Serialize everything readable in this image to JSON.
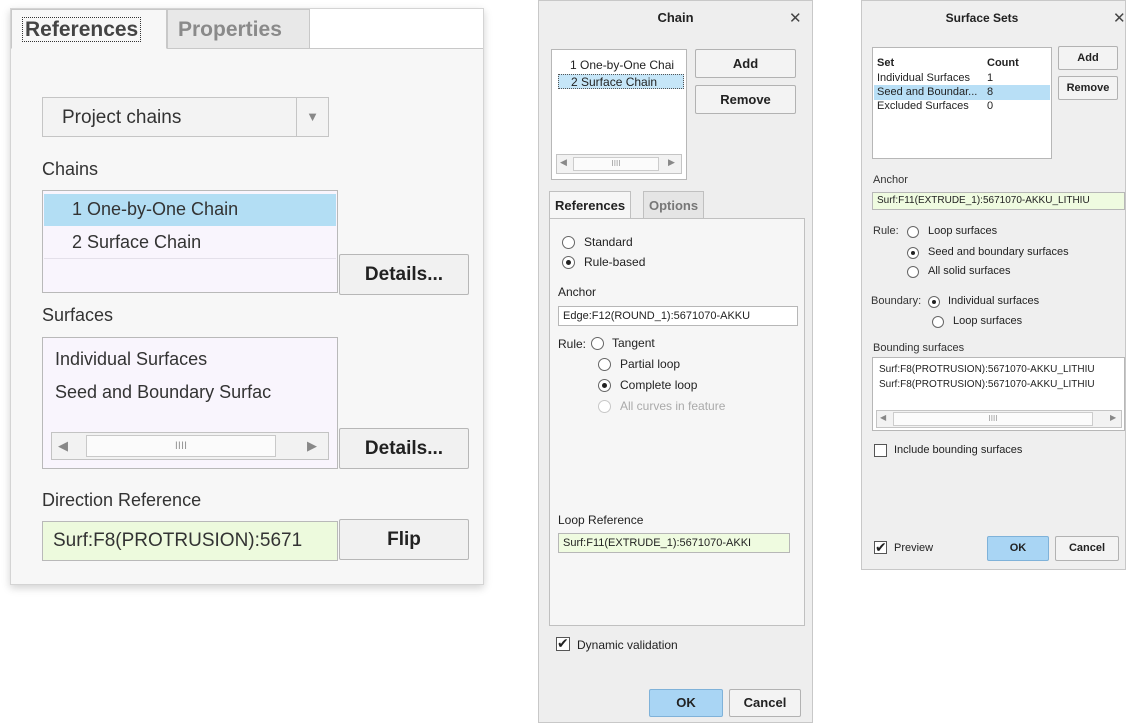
{
  "panel_references": {
    "tabs": [
      "References",
      "Properties"
    ],
    "dropdown_value": "Project chains",
    "chains_label": "Chains",
    "chains": [
      "1 One-by-One Chain",
      "2 Surface Chain"
    ],
    "details_label": "Details...",
    "surfaces_label": "Surfaces",
    "surfaces": [
      "Individual Surfaces",
      "Seed and Boundary Surfac"
    ],
    "direction_label": "Direction Reference",
    "direction_value": "Surf:F8(PROTRUSION):5671",
    "flip_label": "Flip"
  },
  "chain_dialog": {
    "title": "Chain",
    "chains": [
      "1 One-by-One Chai",
      "2 Surface Chain"
    ],
    "add_label": "Add",
    "remove_label": "Remove",
    "tabs": [
      "References",
      "Options"
    ],
    "type_options": [
      "Standard",
      "Rule-based"
    ],
    "anchor_label": "Anchor",
    "anchor_value": "Edge:F12(ROUND_1):5671070-AKKU",
    "rule_label": "Rule:",
    "rules": [
      "Tangent",
      "Partial loop",
      "Complete loop",
      "All curves in feature"
    ],
    "loop_ref_label": "Loop Reference",
    "loop_ref_value": "Surf:F11(EXTRUDE_1):5671070-AKKI",
    "dynamic_validation_label": "Dynamic validation",
    "ok_label": "OK",
    "cancel_label": "Cancel"
  },
  "surface_sets_dialog": {
    "title": "Surface Sets",
    "col_set": "Set",
    "col_count": "Count",
    "rows": [
      {
        "set": "Individual Surfaces",
        "count": "1"
      },
      {
        "set": "Seed and Boundar...",
        "count": "8"
      },
      {
        "set": "Excluded Surfaces",
        "count": "0"
      }
    ],
    "add_label": "Add",
    "remove_label": "Remove",
    "anchor_label": "Anchor",
    "anchor_value": "Surf:F11(EXTRUDE_1):5671070-AKKU_LITHIU",
    "rule_label": "Rule:",
    "rules": [
      "Loop surfaces",
      "Seed and boundary surfaces",
      "All solid surfaces"
    ],
    "boundary_label": "Boundary:",
    "boundary_options": [
      "Individual surfaces",
      "Loop surfaces"
    ],
    "bounding_label": "Bounding surfaces",
    "bounding_items": [
      "Surf:F8(PROTRUSION):5671070-AKKU_LITHIU",
      "Surf:F8(PROTRUSION):5671070-AKKU_LITHIU"
    ],
    "include_bounding_label": "Include bounding surfaces",
    "preview_label": "Preview",
    "ok_label": "OK",
    "cancel_label": "Cancel"
  },
  "colors": {
    "selection_blue": "#b3def4",
    "ok_blue": "#a9d5f4",
    "field_green": "#edfadd",
    "list_lavender": "#f9f5fd"
  }
}
